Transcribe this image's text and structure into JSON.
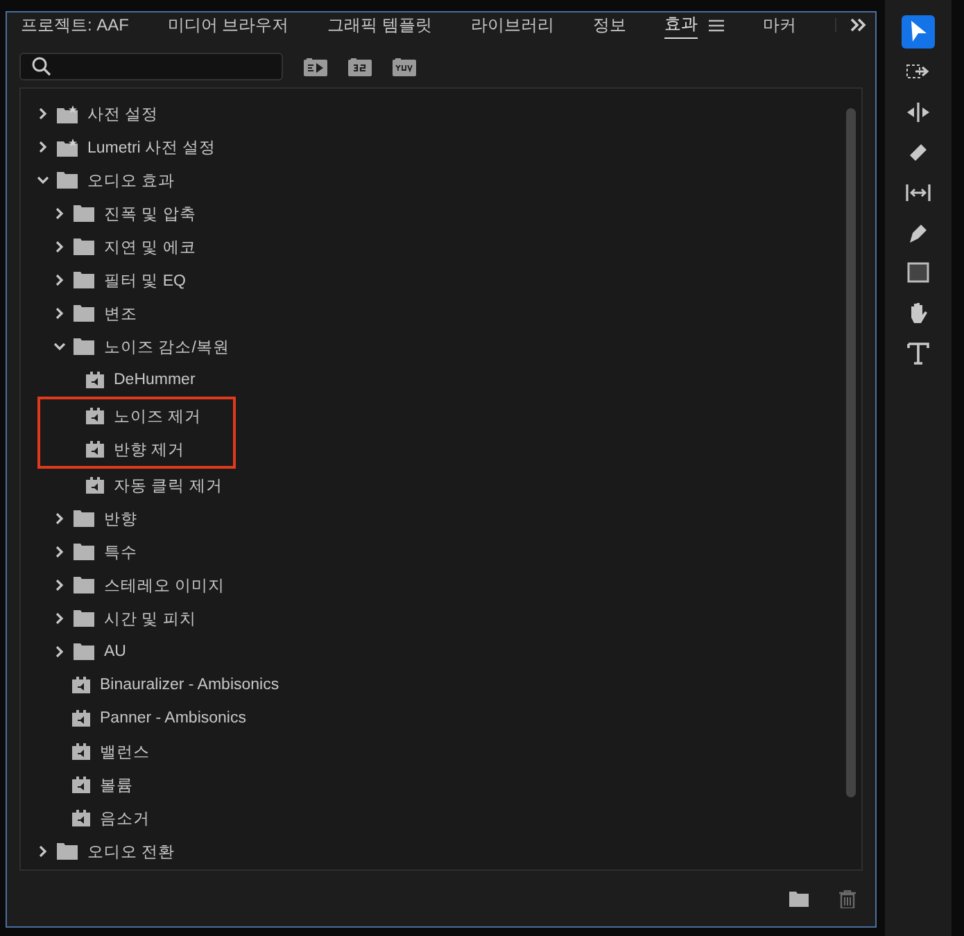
{
  "tabs": [
    {
      "label": "프로젝트: AAF",
      "selected": false
    },
    {
      "label": "미디어 브라우저",
      "selected": false
    },
    {
      "label": "그래픽 템플릿",
      "selected": false
    },
    {
      "label": "라이브러리",
      "selected": false
    },
    {
      "label": "정보",
      "selected": false
    },
    {
      "label": "효과",
      "selected": true
    },
    {
      "label": "마커",
      "selected": false
    }
  ],
  "filters": [
    {
      "kind": "accelerated"
    },
    {
      "kind": "bitdepth"
    },
    {
      "kind": "yuv"
    }
  ],
  "tree": [
    {
      "label": "사전 설정",
      "kind": "preset-folder",
      "expanded": false
    },
    {
      "label": "Lumetri 사전 설정",
      "kind": "preset-folder",
      "expanded": false
    },
    {
      "label": "오디오 효과",
      "kind": "folder",
      "expanded": true,
      "children": [
        {
          "label": "진폭 및 압축",
          "kind": "folder",
          "expanded": false
        },
        {
          "label": "지연 및 에코",
          "kind": "folder",
          "expanded": false
        },
        {
          "label": "필터 및 EQ",
          "kind": "folder",
          "expanded": false
        },
        {
          "label": "변조",
          "kind": "folder",
          "expanded": false
        },
        {
          "label": "노이즈 감소/복원",
          "kind": "folder",
          "expanded": true,
          "children": [
            {
              "label": "DeHummer",
              "kind": "effect",
              "highlighted": false
            },
            {
              "label": "노이즈 제거",
              "kind": "effect",
              "highlighted": true
            },
            {
              "label": "반향 제거",
              "kind": "effect",
              "highlighted": true
            },
            {
              "label": "자동 클릭 제거",
              "kind": "effect",
              "highlighted": false
            }
          ]
        },
        {
          "label": "반향",
          "kind": "folder",
          "expanded": false
        },
        {
          "label": "특수",
          "kind": "folder",
          "expanded": false
        },
        {
          "label": "스테레오 이미지",
          "kind": "folder",
          "expanded": false
        },
        {
          "label": "시간 및 피치",
          "kind": "folder",
          "expanded": false
        },
        {
          "label": "AU",
          "kind": "folder",
          "expanded": false
        },
        {
          "label": "Binauralizer - Ambisonics",
          "kind": "effect",
          "highlighted": false
        },
        {
          "label": "Panner - Ambisonics",
          "kind": "effect",
          "highlighted": false
        },
        {
          "label": "밸런스",
          "kind": "effect",
          "highlighted": false
        },
        {
          "label": "볼륨",
          "kind": "effect",
          "highlighted": false
        },
        {
          "label": "음소거",
          "kind": "effect",
          "highlighted": false
        }
      ]
    },
    {
      "label": "오디오 전환",
      "kind": "folder",
      "expanded": false
    }
  ],
  "tools": [
    {
      "kind": "select",
      "selected": true
    },
    {
      "kind": "track-select",
      "selected": false
    },
    {
      "kind": "ripple",
      "selected": false
    },
    {
      "kind": "razor",
      "selected": false
    },
    {
      "kind": "slip",
      "selected": false
    },
    {
      "kind": "pen",
      "selected": false
    },
    {
      "kind": "rectangle",
      "selected": false
    },
    {
      "kind": "hand",
      "selected": false
    },
    {
      "kind": "type",
      "selected": false
    }
  ]
}
